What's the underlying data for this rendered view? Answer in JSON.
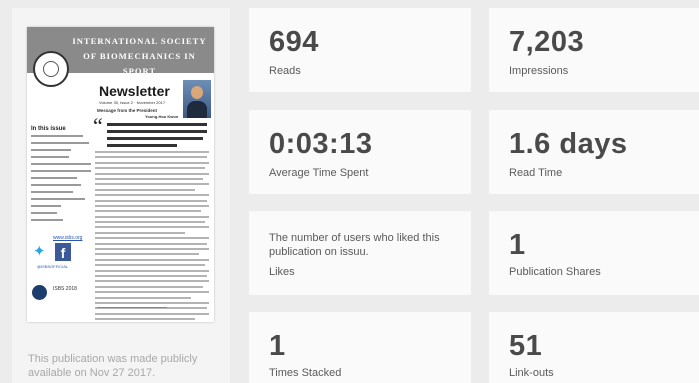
{
  "publication": {
    "cover": {
      "society_title": "INTERNATIONAL SOCIETY OF BIOMECHANICS IN SPORT",
      "heading": "Newsletter",
      "subheading": "Volume 35, Issue 2 · November 2017",
      "message_from": "Message from the President",
      "president_name": "Young-Hoo Kwon",
      "in_this_issue": "In this issue",
      "website": "www.isbs.org",
      "hashtag": "@ISBSOFFICIAL",
      "conference": "ISBS 2018"
    },
    "made_public_text": "This publication was made publicly available on Nov 27 2017."
  },
  "stats": [
    {
      "id": "reads",
      "value": "694",
      "label": "Reads"
    },
    {
      "id": "impressions",
      "value": "7,203",
      "label": "Impressions"
    },
    {
      "id": "avg-time",
      "value": "0:03:13",
      "label": "Average Time Spent"
    },
    {
      "id": "read-time",
      "value": "1.6 days",
      "label": "Read Time"
    },
    {
      "id": "likes",
      "value": "",
      "description": "The number of users who liked this publication on issuu.",
      "label": "Likes"
    },
    {
      "id": "shares",
      "value": "1",
      "label": "Publication Shares"
    },
    {
      "id": "stacked",
      "value": "1",
      "label": "Times Stacked"
    },
    {
      "id": "link-outs",
      "value": "51",
      "label": "Link-outs"
    }
  ]
}
